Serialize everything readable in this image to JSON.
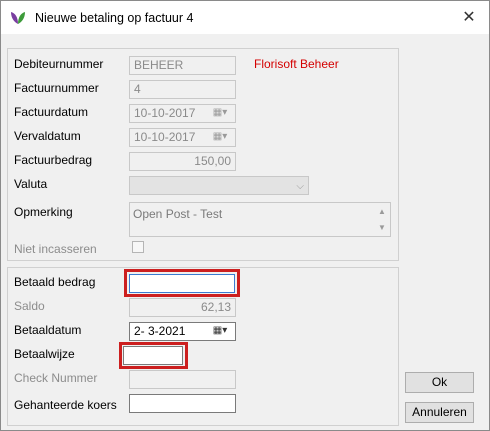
{
  "window": {
    "title": "Nieuwe betaling op factuur 4",
    "close_glyph": "✕",
    "logo_icon": "florisoft-logo-icon"
  },
  "invoice": {
    "debtor_label": "Debiteurnummer",
    "debtor_value": "BEHEER",
    "debtor_name": "Florisoft Beheer",
    "invoice_number_label": "Factuurnummer",
    "invoice_number_value": "4",
    "invoice_date_label": "Factuurdatum",
    "invoice_date_value": "10-10-2017",
    "due_date_label": "Vervaldatum",
    "due_date_value": "10-10-2017",
    "amount_label": "Factuurbedrag",
    "amount_value": "150,00",
    "currency_label": "Valuta",
    "currency_value": "",
    "remark_label": "Opmerking",
    "remark_value": "Open Post - Test",
    "no_collect_label": "Niet incasseren",
    "no_collect_checked": false
  },
  "payment": {
    "paid_amount_label": "Betaald bedrag",
    "paid_amount_value": "",
    "balance_label": "Saldo",
    "balance_value": "62,13",
    "pay_date_label": "Betaaldatum",
    "pay_date_value": "2- 3-2021",
    "pay_method_label": "Betaalwijze",
    "pay_method_value": "",
    "check_number_label": "Check Nummer",
    "check_number_value": "",
    "used_rate_label": "Gehanteerde koers",
    "used_rate_value": ""
  },
  "buttons": {
    "ok": "Ok",
    "cancel": "Annuleren"
  },
  "colors": {
    "highlight": "#cc1f1f",
    "debtor_name": "#d40000"
  }
}
